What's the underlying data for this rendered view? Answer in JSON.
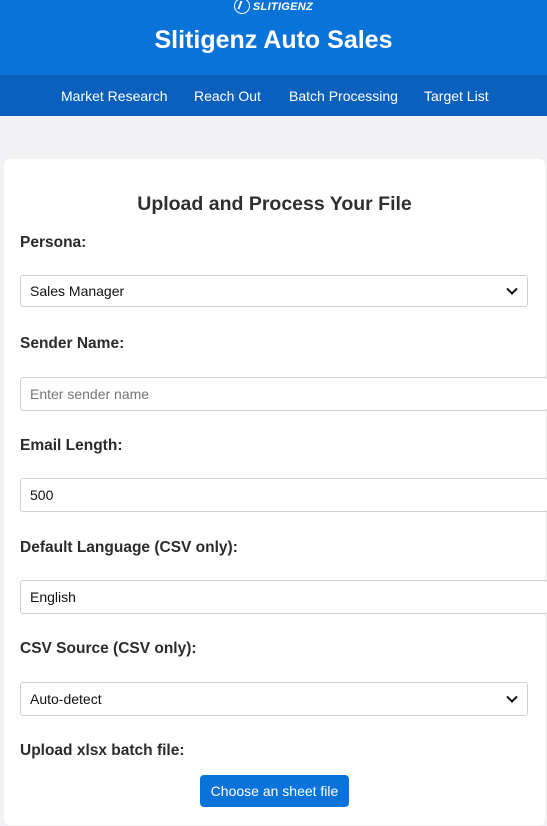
{
  "brand": {
    "logo_text": "SLITIGENZ",
    "app_title": "Slitigenz Auto Sales"
  },
  "nav": {
    "items": [
      {
        "label": "Market Research"
      },
      {
        "label": "Reach Out"
      },
      {
        "label": "Batch Processing"
      },
      {
        "label": "Target List"
      }
    ]
  },
  "form": {
    "title": "Upload and Process Your File",
    "persona": {
      "label": "Persona:",
      "value": "Sales Manager"
    },
    "sender_name": {
      "label": "Sender Name:",
      "placeholder": "Enter sender name",
      "value": ""
    },
    "email_length": {
      "label": "Email Length:",
      "value": "500"
    },
    "default_language": {
      "label": "Default Language (CSV only):",
      "value": "English"
    },
    "csv_source": {
      "label": "CSV Source (CSV only):",
      "value": "Auto-detect"
    },
    "upload": {
      "label": "Upload xlsx batch file:",
      "button_label": "Choose an sheet file"
    }
  },
  "colors": {
    "primary": "#0a73d9",
    "nav_bg": "#0b5fbd",
    "page_bg": "#f2f2f5"
  },
  "icons": {
    "logo": "slitigenz-logo-icon",
    "select_arrow": "chevron-down-icon"
  }
}
